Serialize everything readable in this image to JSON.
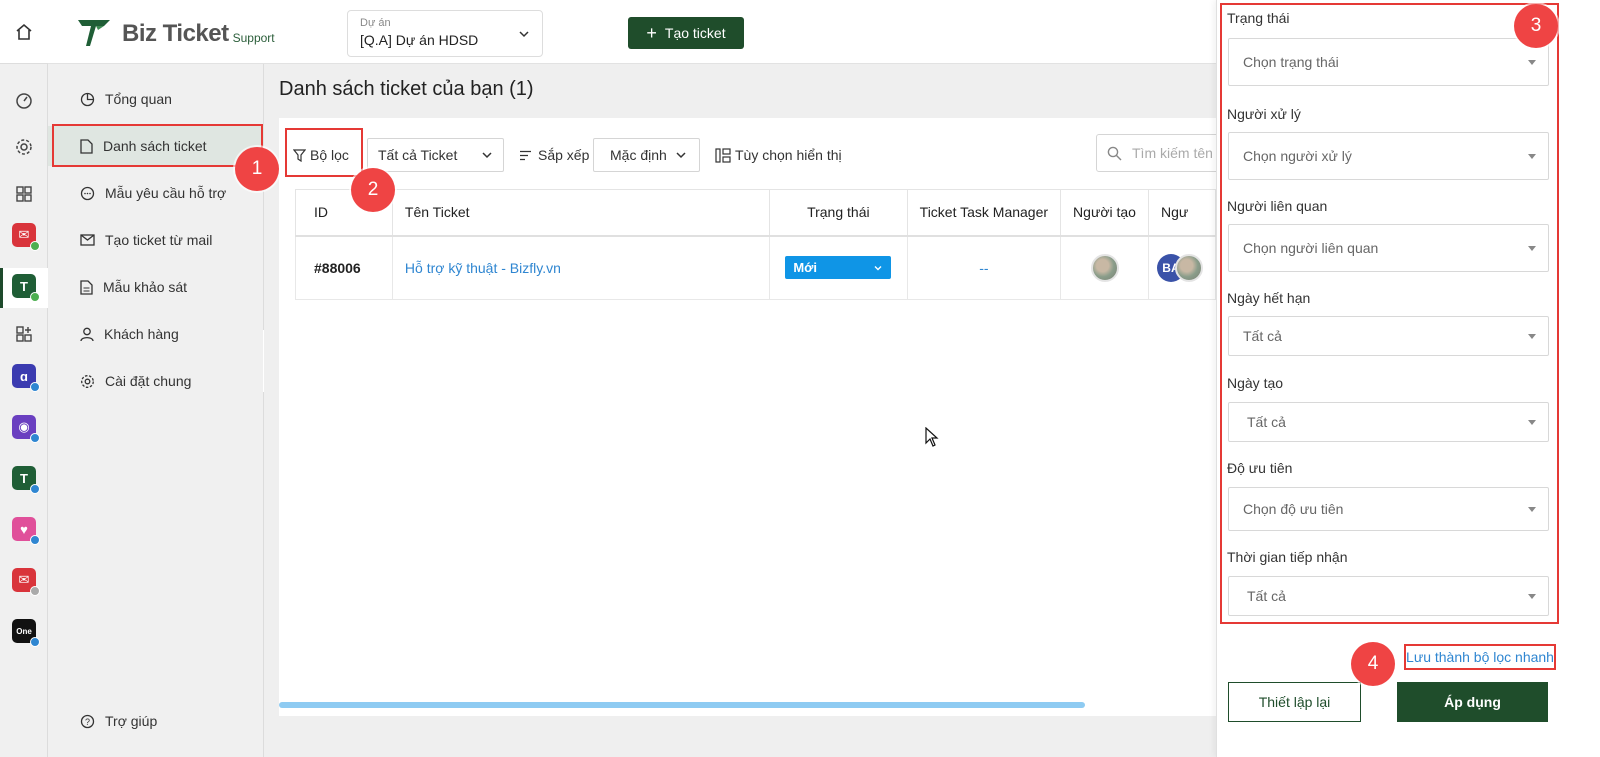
{
  "app": {
    "logo_name": "Biz Ticket",
    "logo_sub": "Support",
    "brand_color": "#1f4d2b",
    "accent_color": "#2f86d1",
    "annotation_color": "#e53935"
  },
  "header": {
    "project_label": "Dự án",
    "project_value": "[Q.A] Dự án HDSD",
    "create_button": "Tạo ticket"
  },
  "rail": {
    "icons": [
      "home-icon",
      "dashboard-icon",
      "settings-icon",
      "grid-icon",
      "mail-app-icon",
      "bizticket-app-icon",
      "apps-add-icon",
      "app-icon",
      "bot-app-icon",
      "bizticket-app-icon-2",
      "heart-app-icon",
      "mail-app-icon-2",
      "onex-app-icon"
    ],
    "onex_label": "One"
  },
  "sidebar": {
    "items": [
      {
        "label": "Tổng quan",
        "icon": "pie-chart-icon"
      },
      {
        "label": "Danh sách ticket",
        "icon": "document-icon",
        "active": true
      },
      {
        "label": "Mẫu yêu cầu hỗ trợ",
        "icon": "chat-bubble-icon"
      },
      {
        "label": "Tạo ticket từ mail",
        "icon": "mail-icon"
      },
      {
        "label": "Mẫu khảo sát",
        "icon": "survey-icon"
      },
      {
        "label": "Khách hàng",
        "icon": "user-icon"
      },
      {
        "label": "Cài đặt chung",
        "icon": "gear-icon"
      }
    ],
    "help": "Trợ giúp"
  },
  "main": {
    "title": "Danh sách ticket của bạn (1)",
    "toolbar": {
      "filter": "Bộ lọc",
      "ticket_scope": "Tất cả Ticket",
      "sort_label": "Sắp xếp",
      "sort_value": "Mặc định",
      "display_options": "Tùy chọn hiển thị",
      "search_placeholder": "Tìm kiếm tên"
    },
    "table": {
      "columns": [
        "ID",
        "Tên Ticket",
        "Trạng thái",
        "Ticket Task Manager",
        "Người tạo",
        "Ngư"
      ],
      "rows": [
        {
          "id": "#88006",
          "name": "Hỗ trợ kỹ thuật - Bizfly.vn",
          "status": "Mới",
          "task_manager": "--",
          "creator": "avatar-photo",
          "assignee_initials": "BA"
        }
      ]
    }
  },
  "filter_panel": {
    "fields": [
      {
        "label": "Trạng thái",
        "value": "Chọn trạng thái"
      },
      {
        "label": "Người xử lý",
        "value": "Chọn người xử lý"
      },
      {
        "label": "Người liên quan",
        "value": "Chọn người liên quan"
      },
      {
        "label": "Ngày hết hạn",
        "value": "Tất cả"
      },
      {
        "label": "Ngày tạo",
        "value": "Tất cả"
      },
      {
        "label": "Độ ưu tiên",
        "value": "Chọn độ ưu tiên"
      },
      {
        "label": "Thời gian tiếp nhận",
        "value": "Tất cả"
      }
    ],
    "save_quick_filter": "Lưu thành bộ lọc nhanh",
    "reset_button": "Thiết lập lại",
    "apply_button": "Áp dụng"
  },
  "annotations": [
    "1",
    "2",
    "3",
    "4"
  ]
}
